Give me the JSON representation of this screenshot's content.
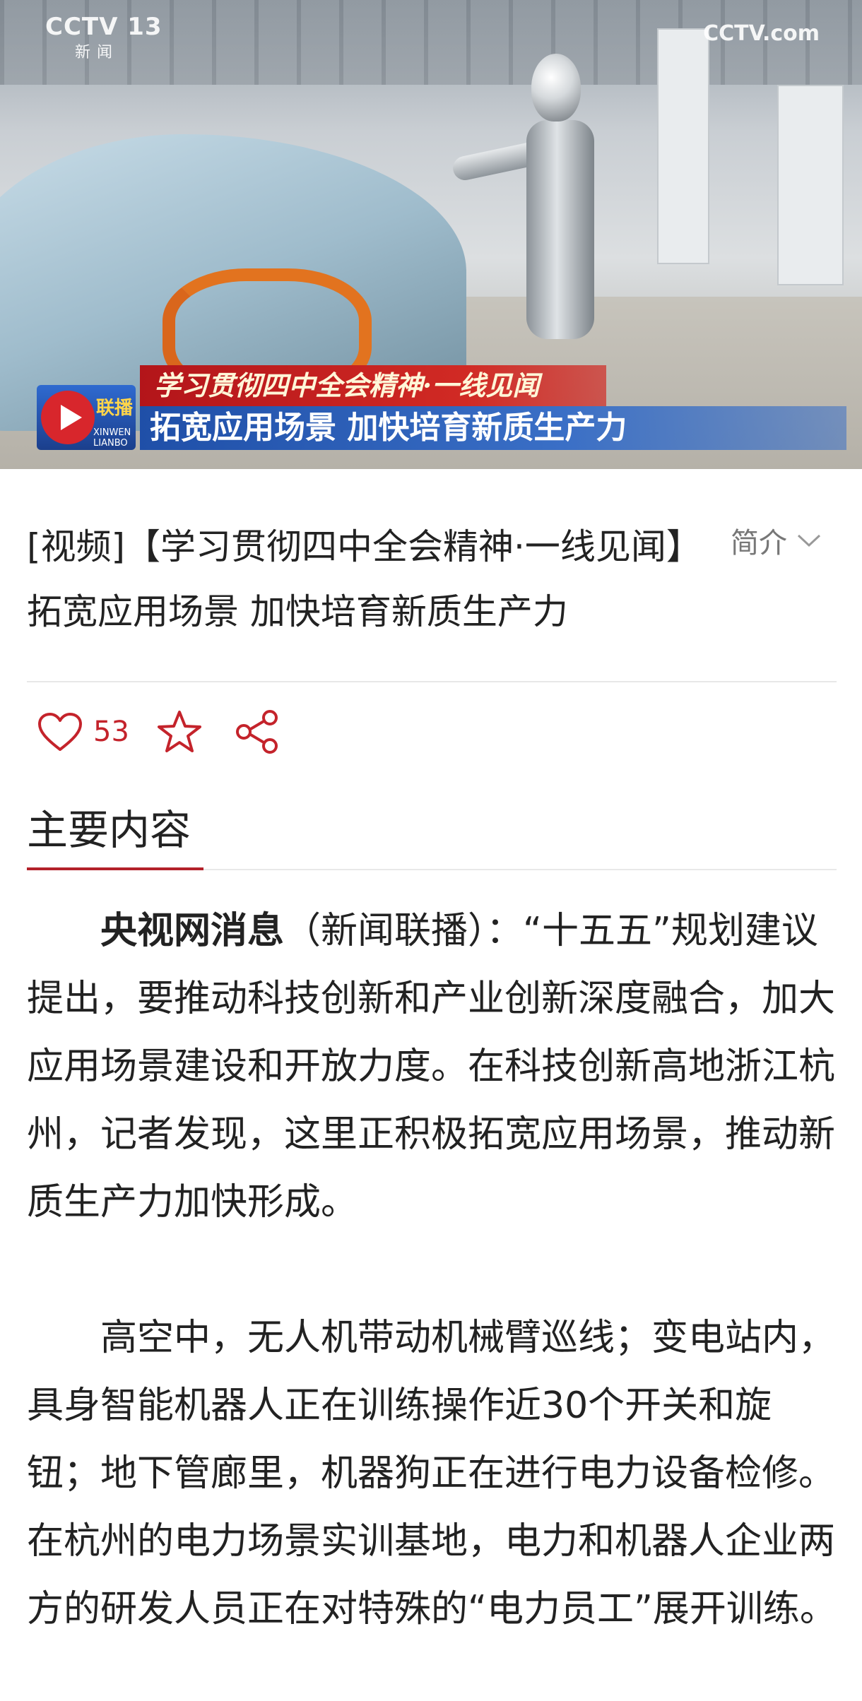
{
  "video": {
    "channel_logo": "CCTV 13",
    "channel_sub": "新 闻",
    "watermark": "CCTV.com",
    "program_logo_text": "联播",
    "program_logo_sub": "XINWEN LIANBO",
    "banner_top": "学习贯彻四中全会精神·一线见闻",
    "banner_bottom": "拓宽应用场景 加快培育新质生产力"
  },
  "header": {
    "title": "[视频]【学习贯彻四中全会精神·一线见闻】拓宽应用场景 加快培育新质生产力",
    "intro_label": "简介"
  },
  "actions": {
    "like_count": "53",
    "like_icon": "heart-icon",
    "favorite_icon": "star-icon",
    "share_icon": "share-icon"
  },
  "section": {
    "title": "主要内容"
  },
  "article": {
    "p1_lead": "央视网消息",
    "p1_rest": "（新闻联播）：“十五五”规划建议提出，要推动科技创新和产业创新深度融合，加大应用场景建设和开放力度。在科技创新高地浙江杭州，记者发现，这里正积极拓宽应用场景，推动新质生产力加快形成。",
    "p2": "高空中，无人机带动机械臂巡线；变电站内，具身智能机器人正在训练操作近30个开关和旋钮；地下管廊里，机器狗正在进行电力设备检修。在杭州的电力场景实训基地，电力和机器人企业两方的研发人员正在对特殊的“电力员工”展开训练。"
  },
  "colors": {
    "accent_red": "#b3212a",
    "like_red": "#c4232b",
    "banner_red": "#d12a24",
    "banner_blue": "#1f4fa8"
  }
}
